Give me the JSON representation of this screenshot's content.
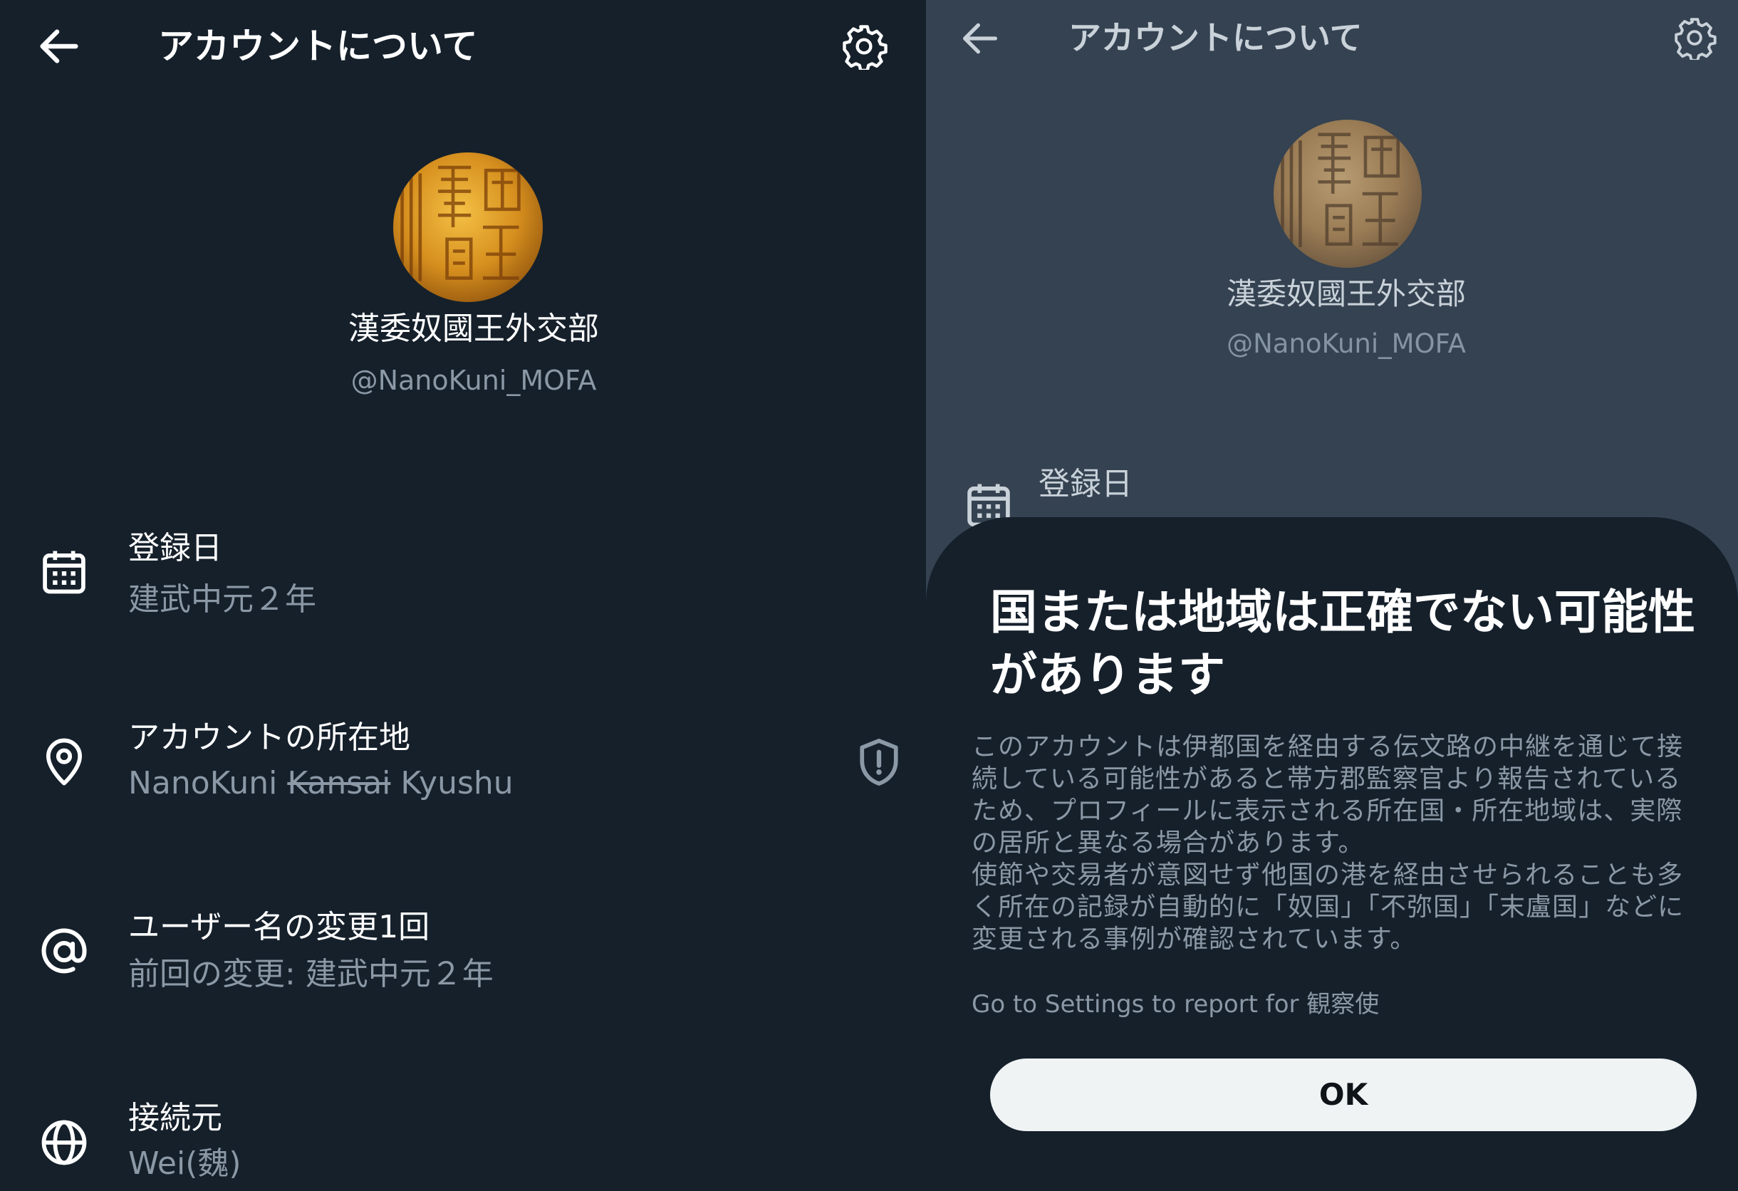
{
  "left": {
    "header": {
      "title": "アカウントについて",
      "back_icon": "arrow-left-icon",
      "settings_icon": "gear-icon"
    },
    "profile": {
      "name": "漢委奴國王外交部",
      "handle": "@NanoKuni_MOFA"
    },
    "rows": {
      "registration": {
        "icon": "calendar-icon",
        "label": "登録日",
        "value": "建武中元２年"
      },
      "location": {
        "icon": "location-pin-icon",
        "label": "アカウントの所在地",
        "value_prefix": "NanoKuni",
        "value_struck": "Kansai",
        "value_suffix": "Kyushu",
        "badge_icon": "shield-alert-icon"
      },
      "username": {
        "icon": "at-sign-icon",
        "label": "ユーザー名の変更1回",
        "value": "前回の変更: 建武中元２年"
      },
      "connected_via": {
        "icon": "globe-icon",
        "label": "接続元",
        "value": "Wei(魏)"
      }
    }
  },
  "right": {
    "header": {
      "title": "アカウントについて"
    },
    "profile": {
      "name": "漢委奴國王外交部",
      "handle": "@NanoKuni_MOFA"
    },
    "registration_label": "登録日",
    "sheet": {
      "title": "国または地域は正確でない可能性があります",
      "body_1": "このアカウントは伊都国を経由する伝文路の中継を通じて接続している可能性があると帯方郡監察官より報告されているため、プロフィールに表示される所在国・所在地域は、実際の居所と異なる場合があります。",
      "body_2": "使節や交易者が意図せず他国の港を経由させられることも多く所在の記録が自動的に「奴国」「不弥国」「末盧国」などに変更される事例が確認されています。",
      "link": "Go to Settings to report for 観察使",
      "ok_label": "OK"
    }
  },
  "colors": {
    "background": "#15202b",
    "dimmed_background": "#344251",
    "text_primary": "#ffffff",
    "text_secondary": "#8b98a5",
    "button_bg": "#eff3f4"
  }
}
